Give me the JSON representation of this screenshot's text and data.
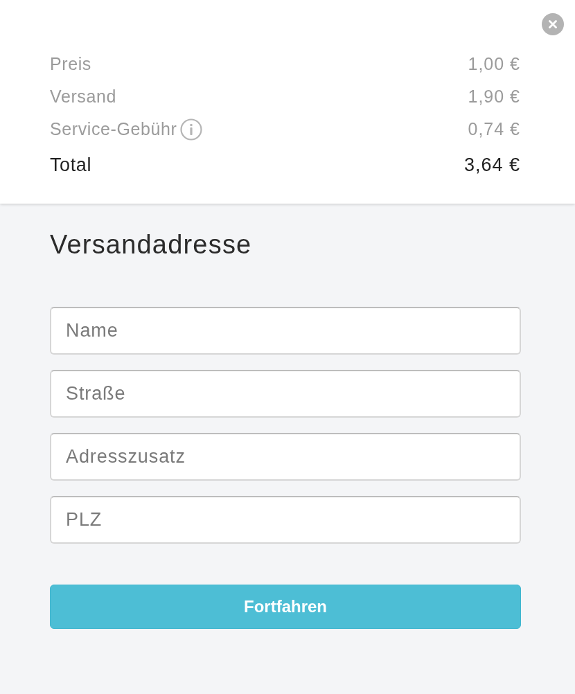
{
  "summary": {
    "rows": [
      {
        "kind": "item",
        "label": "Preis",
        "value": "1,00 €",
        "info": false
      },
      {
        "kind": "item",
        "label": "Versand",
        "value": "1,90 €",
        "info": false
      },
      {
        "kind": "item",
        "label": "Service-Gebühr",
        "value": "0,74 €",
        "info": true
      },
      {
        "kind": "total",
        "label": "Total",
        "value": "3,64 €",
        "info": false
      }
    ]
  },
  "form": {
    "title": "Versandadresse",
    "fields": [
      {
        "placeholder": "Name"
      },
      {
        "placeholder": "Straße"
      },
      {
        "placeholder": "Adresszusatz"
      },
      {
        "placeholder": "PLZ"
      }
    ],
    "submit": "Fortfahren"
  }
}
